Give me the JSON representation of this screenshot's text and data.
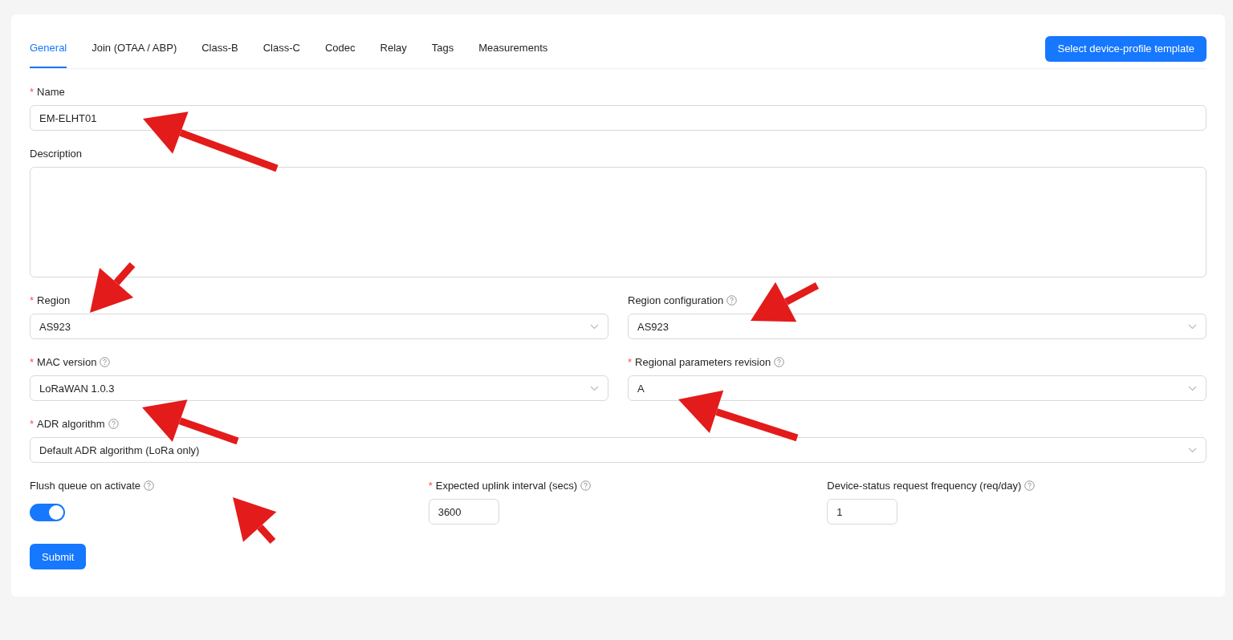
{
  "tabs": [
    {
      "label": "General",
      "selected": true
    },
    {
      "label": "Join (OTAA / ABP)",
      "selected": false
    },
    {
      "label": "Class-B",
      "selected": false
    },
    {
      "label": "Class-C",
      "selected": false
    },
    {
      "label": "Codec",
      "selected": false
    },
    {
      "label": "Relay",
      "selected": false
    },
    {
      "label": "Tags",
      "selected": false
    },
    {
      "label": "Measurements",
      "selected": false
    }
  ],
  "template_button": "Select device-profile template",
  "rows": [
    [
      {
        "kind": "text",
        "label": "Name",
        "required_mark": "*",
        "help": false,
        "value": "EM-ELHT01"
      }
    ],
    [
      {
        "kind": "textarea",
        "label": "Description",
        "help": false
      }
    ],
    [
      {
        "kind": "select",
        "label": "Region",
        "required_mark": "*",
        "help": false,
        "value": "AS923"
      },
      {
        "kind": "select",
        "label": "Region configuration",
        "help": true,
        "value": "AS923"
      }
    ],
    [
      {
        "kind": "select",
        "label": "MAC version",
        "required_mark": "*",
        "help": true,
        "value": "LoRaWAN 1.0.3"
      },
      {
        "kind": "select",
        "label": "Regional parameters revision",
        "required_mark": "*",
        "help": true,
        "value": "A"
      }
    ],
    [
      {
        "kind": "select",
        "label": "ADR algorithm",
        "required_mark": "*",
        "help": true,
        "value": "Default ADR algorithm (LoRa only)"
      }
    ],
    [
      {
        "kind": "switch",
        "label": "Flush queue on activate",
        "help": true,
        "on": true
      },
      {
        "kind": "number",
        "label": "Expected uplink interval (secs)",
        "required_mark": "*",
        "help": true,
        "value": "3600"
      },
      {
        "kind": "number",
        "label": "Device-status request frequency (req/day)",
        "help": true,
        "value": "1"
      }
    ]
  ],
  "submit_button": "Submit"
}
